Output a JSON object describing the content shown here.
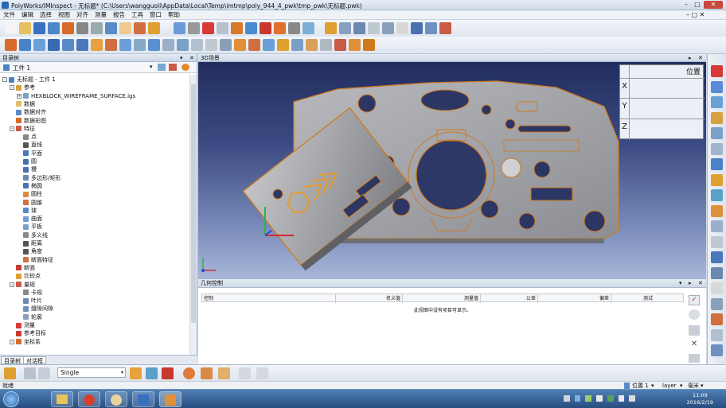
{
  "window": {
    "title": "PolyWorks/IMInspect - 无标题* (C:\\Users\\wangguoli\\AppData\\Local\\Temp\\imtmp\\poly_944_4_pwk\\tmp_pwk\\无标题.pwk)"
  },
  "menu": [
    "文件",
    "编辑",
    "选择",
    "视图",
    "对齐",
    "测量",
    "报告",
    "工具",
    "窗口",
    "帮助"
  ],
  "left_panel": {
    "title": "目录树",
    "workspace": "工件 1",
    "tree": [
      {
        "label": "无标题 - 工件 1",
        "level": 0,
        "icon": "root",
        "expand": "-"
      },
      {
        "label": "参考",
        "level": 1,
        "icon": "ref",
        "expand": "-"
      },
      {
        "label": "HEXBLOCK_WIREFRAME_SURFACE.igs",
        "level": 2,
        "icon": "cad",
        "expand": "+"
      },
      {
        "label": "数据",
        "level": 1,
        "icon": "data",
        "expand": ""
      },
      {
        "label": "数据对齐",
        "level": 1,
        "icon": "align",
        "expand": ""
      },
      {
        "label": "数据彩图",
        "level": 1,
        "icon": "colormap",
        "expand": ""
      },
      {
        "label": "特征",
        "level": 1,
        "icon": "feature",
        "expand": "-"
      },
      {
        "label": "点",
        "level": 2,
        "icon": "point",
        "expand": ""
      },
      {
        "label": "直线",
        "level": 2,
        "icon": "line",
        "expand": ""
      },
      {
        "label": "平面",
        "level": 2,
        "icon": "plane",
        "expand": ""
      },
      {
        "label": "圆",
        "level": 2,
        "icon": "circle",
        "expand": ""
      },
      {
        "label": "槽",
        "level": 2,
        "icon": "slot",
        "expand": ""
      },
      {
        "label": "多边形/矩形",
        "level": 2,
        "icon": "polygon",
        "expand": ""
      },
      {
        "label": "椭圆",
        "level": 2,
        "icon": "ellipse",
        "expand": ""
      },
      {
        "label": "圆柱",
        "level": 2,
        "icon": "cylinder",
        "expand": ""
      },
      {
        "label": "圆锥",
        "level": 2,
        "icon": "cone",
        "expand": ""
      },
      {
        "label": "球",
        "level": 2,
        "icon": "sphere",
        "expand": ""
      },
      {
        "label": "曲面",
        "level": 2,
        "icon": "surface",
        "expand": ""
      },
      {
        "label": "平板",
        "level": 2,
        "icon": "slab",
        "expand": ""
      },
      {
        "label": "多义线",
        "level": 2,
        "icon": "polyline",
        "expand": ""
      },
      {
        "label": "距离",
        "level": 2,
        "icon": "distance",
        "expand": ""
      },
      {
        "label": "角度",
        "level": 2,
        "icon": "angle",
        "expand": ""
      },
      {
        "label": "断面特征",
        "level": 2,
        "icon": "section-feature",
        "expand": ""
      },
      {
        "label": "断面",
        "level": 1,
        "icon": "section",
        "expand": ""
      },
      {
        "label": "比较点",
        "level": 1,
        "icon": "compare",
        "expand": ""
      },
      {
        "label": "量规",
        "level": 1,
        "icon": "gauge",
        "expand": "-"
      },
      {
        "label": "卡规",
        "level": 2,
        "icon": "caliper",
        "expand": ""
      },
      {
        "label": "叶片",
        "level": 2,
        "icon": "blade",
        "expand": ""
      },
      {
        "label": "缝隙间隙",
        "level": 2,
        "icon": "gap",
        "expand": ""
      },
      {
        "label": "轮廓",
        "level": 2,
        "icon": "profile",
        "expand": ""
      },
      {
        "label": "测量",
        "level": 1,
        "icon": "measure",
        "expand": ""
      },
      {
        "label": "参考目标",
        "level": 1,
        "icon": "target",
        "expand": ""
      },
      {
        "label": "坐标系",
        "level": 1,
        "icon": "csys",
        "expand": "-"
      }
    ],
    "tabs": [
      "目录树",
      "对话框"
    ]
  },
  "scene": {
    "title": "3D场景",
    "position_table": {
      "title": "位置",
      "rows": [
        "X",
        "Y",
        "Z"
      ]
    }
  },
  "geo_panel": {
    "title": "几何控制",
    "columns": [
      "控制",
      "名义值",
      "测量值",
      "公差",
      "偏差",
      "测试"
    ],
    "empty_message": "此视图中没有项目可显示。"
  },
  "bottom": {
    "mode": "Single"
  },
  "status": {
    "left": "就绪",
    "position": "位置 1",
    "layer": "layer",
    "unit": "毫米"
  },
  "taskbar": {
    "time": "11:09",
    "date": "2016/2/19"
  },
  "colors": {
    "part": "#9c9ea2",
    "edge": "#d07a1e",
    "accent": "#e89a2a"
  }
}
